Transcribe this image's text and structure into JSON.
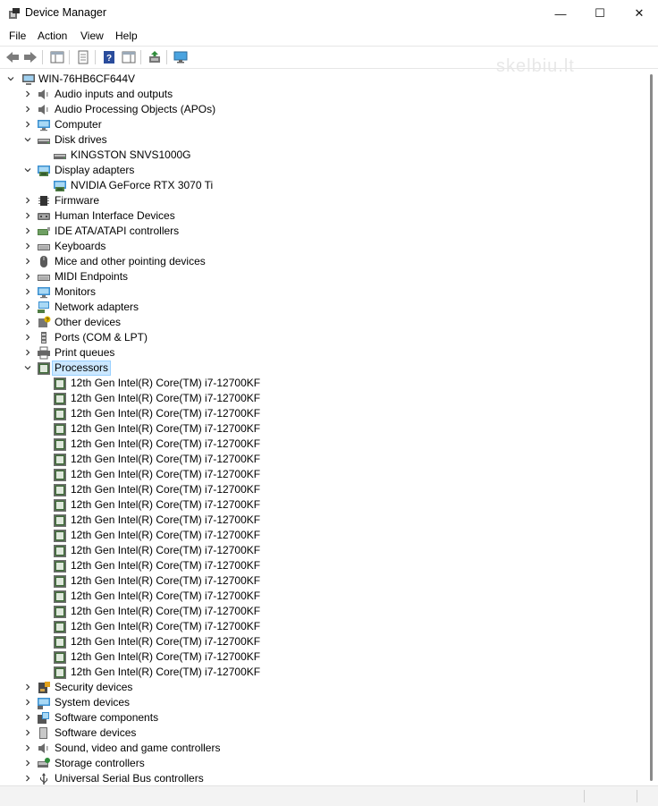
{
  "window": {
    "title": "Device Manager",
    "watermark": "skelbiu.lt",
    "minimize_glyph": "—",
    "maximize_glyph": "☐",
    "close_glyph": "✕"
  },
  "menu": {
    "items": [
      {
        "label": "File",
        "name": "menu-file"
      },
      {
        "label": "Action",
        "name": "menu-action"
      },
      {
        "label": "View",
        "name": "menu-view"
      },
      {
        "label": "Help",
        "name": "menu-help"
      }
    ]
  },
  "toolbar": {
    "buttons": [
      "back-icon",
      "forward-icon",
      "show-hide-console-tree-icon",
      "properties-icon",
      "help-icon",
      "action-pane-icon",
      "update-driver-icon",
      "scan-hardware-icon"
    ]
  },
  "tree": {
    "root": "WIN-76HB6CF644V",
    "nodes": [
      {
        "label": "Audio inputs and outputs",
        "icon": "speaker-icon",
        "expanded": false,
        "level": 1
      },
      {
        "label": "Audio Processing Objects (APOs)",
        "icon": "speaker-icon",
        "expanded": false,
        "level": 1
      },
      {
        "label": "Computer",
        "icon": "monitor-icon",
        "expanded": false,
        "level": 1
      },
      {
        "label": "Disk drives",
        "icon": "disk-drive-icon",
        "expanded": true,
        "level": 1
      },
      {
        "label": "KINGSTON SNVS1000G",
        "icon": "disk-drive-icon",
        "level": 2
      },
      {
        "label": "Display adapters",
        "icon": "display-adapter-icon",
        "expanded": true,
        "level": 1
      },
      {
        "label": "NVIDIA GeForce RTX 3070 Ti",
        "icon": "display-adapter-icon",
        "level": 2
      },
      {
        "label": "Firmware",
        "icon": "chip-icon",
        "expanded": false,
        "level": 1
      },
      {
        "label": "Human Interface Devices",
        "icon": "hid-icon",
        "expanded": false,
        "level": 1
      },
      {
        "label": "IDE ATA/ATAPI controllers",
        "icon": "controller-icon",
        "expanded": false,
        "level": 1
      },
      {
        "label": "Keyboards",
        "icon": "keyboard-icon",
        "expanded": false,
        "level": 1
      },
      {
        "label": "Mice and other pointing devices",
        "icon": "mouse-icon",
        "expanded": false,
        "level": 1
      },
      {
        "label": "MIDI Endpoints",
        "icon": "keyboard-icon",
        "expanded": false,
        "level": 1
      },
      {
        "label": "Monitors",
        "icon": "monitor-icon",
        "expanded": false,
        "level": 1
      },
      {
        "label": "Network adapters",
        "icon": "network-icon",
        "expanded": false,
        "level": 1
      },
      {
        "label": "Other devices",
        "icon": "unknown-device-icon",
        "expanded": false,
        "level": 1
      },
      {
        "label": "Ports (COM & LPT)",
        "icon": "port-icon",
        "expanded": false,
        "level": 1
      },
      {
        "label": "Print queues",
        "icon": "printer-icon",
        "expanded": false,
        "level": 1
      },
      {
        "label": "Processors",
        "icon": "processor-icon",
        "expanded": true,
        "level": 1,
        "selected": true
      },
      {
        "label": "12th Gen Intel(R) Core(TM) i7-12700KF",
        "icon": "processor-icon",
        "level": 2
      },
      {
        "label": "12th Gen Intel(R) Core(TM) i7-12700KF",
        "icon": "processor-icon",
        "level": 2
      },
      {
        "label": "12th Gen Intel(R) Core(TM) i7-12700KF",
        "icon": "processor-icon",
        "level": 2
      },
      {
        "label": "12th Gen Intel(R) Core(TM) i7-12700KF",
        "icon": "processor-icon",
        "level": 2
      },
      {
        "label": "12th Gen Intel(R) Core(TM) i7-12700KF",
        "icon": "processor-icon",
        "level": 2
      },
      {
        "label": "12th Gen Intel(R) Core(TM) i7-12700KF",
        "icon": "processor-icon",
        "level": 2
      },
      {
        "label": "12th Gen Intel(R) Core(TM) i7-12700KF",
        "icon": "processor-icon",
        "level": 2
      },
      {
        "label": "12th Gen Intel(R) Core(TM) i7-12700KF",
        "icon": "processor-icon",
        "level": 2
      },
      {
        "label": "12th Gen Intel(R) Core(TM) i7-12700KF",
        "icon": "processor-icon",
        "level": 2
      },
      {
        "label": "12th Gen Intel(R) Core(TM) i7-12700KF",
        "icon": "processor-icon",
        "level": 2
      },
      {
        "label": "12th Gen Intel(R) Core(TM) i7-12700KF",
        "icon": "processor-icon",
        "level": 2
      },
      {
        "label": "12th Gen Intel(R) Core(TM) i7-12700KF",
        "icon": "processor-icon",
        "level": 2
      },
      {
        "label": "12th Gen Intel(R) Core(TM) i7-12700KF",
        "icon": "processor-icon",
        "level": 2
      },
      {
        "label": "12th Gen Intel(R) Core(TM) i7-12700KF",
        "icon": "processor-icon",
        "level": 2
      },
      {
        "label": "12th Gen Intel(R) Core(TM) i7-12700KF",
        "icon": "processor-icon",
        "level": 2
      },
      {
        "label": "12th Gen Intel(R) Core(TM) i7-12700KF",
        "icon": "processor-icon",
        "level": 2
      },
      {
        "label": "12th Gen Intel(R) Core(TM) i7-12700KF",
        "icon": "processor-icon",
        "level": 2
      },
      {
        "label": "12th Gen Intel(R) Core(TM) i7-12700KF",
        "icon": "processor-icon",
        "level": 2
      },
      {
        "label": "12th Gen Intel(R) Core(TM) i7-12700KF",
        "icon": "processor-icon",
        "level": 2
      },
      {
        "label": "12th Gen Intel(R) Core(TM) i7-12700KF",
        "icon": "processor-icon",
        "level": 2
      },
      {
        "label": "Security devices",
        "icon": "security-icon",
        "expanded": false,
        "level": 1
      },
      {
        "label": "System devices",
        "icon": "system-icon",
        "expanded": false,
        "level": 1
      },
      {
        "label": "Software components",
        "icon": "software-component-icon",
        "expanded": false,
        "level": 1
      },
      {
        "label": "Software devices",
        "icon": "software-device-icon",
        "expanded": false,
        "level": 1
      },
      {
        "label": "Sound, video and game controllers",
        "icon": "speaker-icon",
        "expanded": false,
        "level": 1
      },
      {
        "label": "Storage controllers",
        "icon": "storage-controller-icon",
        "expanded": false,
        "level": 1
      },
      {
        "label": "Universal Serial Bus controllers",
        "icon": "usb-icon",
        "expanded": false,
        "level": 1
      }
    ]
  },
  "colors": {
    "selection_bg": "#cce8ff",
    "selection_border": "#99d1ff",
    "chip_green": "#3a6b35"
  }
}
